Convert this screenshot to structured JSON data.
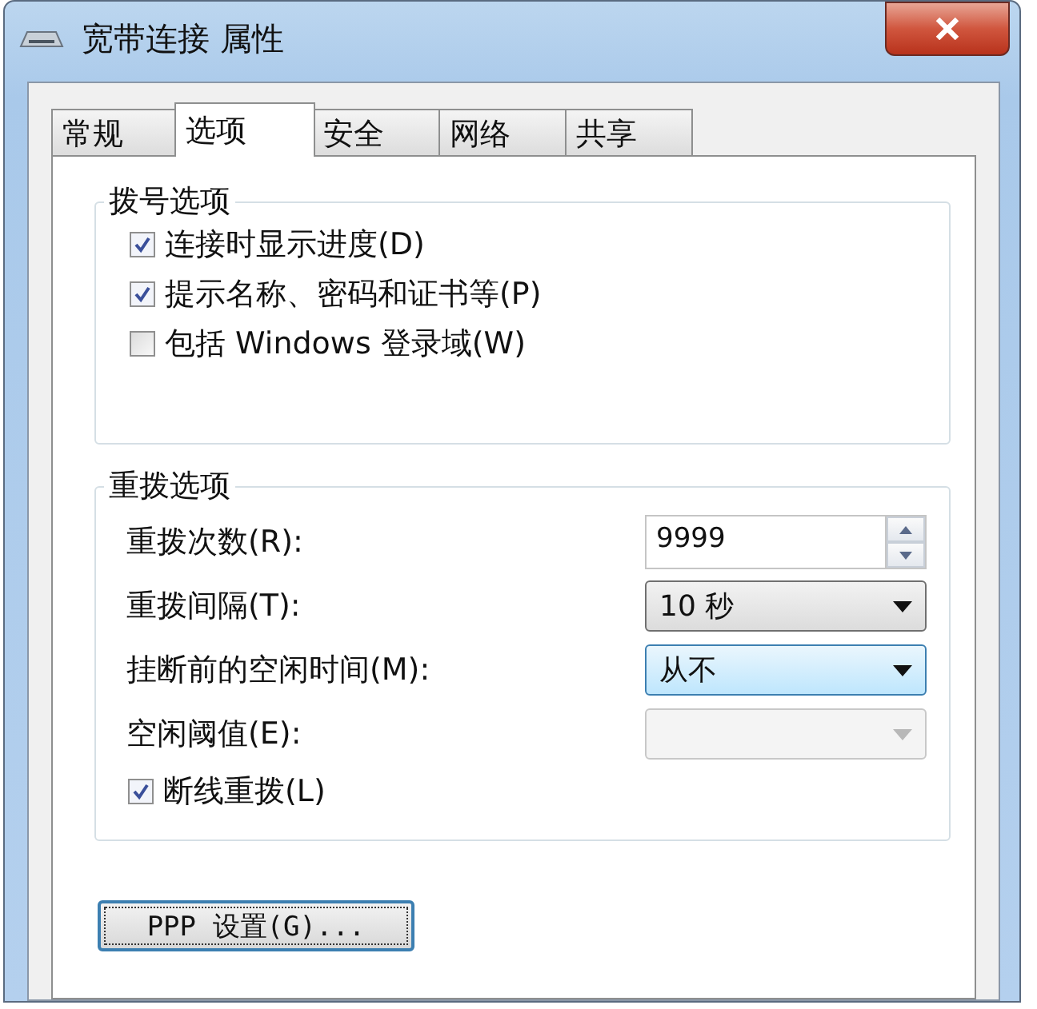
{
  "window": {
    "title": "宽带连接 属性"
  },
  "tabs": [
    {
      "label": "常规",
      "selected": false
    },
    {
      "label": "选项",
      "selected": true
    },
    {
      "label": "安全",
      "selected": false
    },
    {
      "label": "网络",
      "selected": false
    },
    {
      "label": "共享",
      "selected": false
    }
  ],
  "dial_options": {
    "legend": "拨号选项",
    "items": [
      {
        "label": "连接时显示进度(D)",
        "checked": true
      },
      {
        "label": "提示名称、密码和证书等(P)",
        "checked": true
      },
      {
        "label": "包括 Windows 登录域(W)",
        "checked": false
      }
    ]
  },
  "redial_options": {
    "legend": "重拨选项",
    "fields": [
      {
        "kind": "spinner",
        "label": "重拨次数(R):",
        "value": "9999",
        "focused": false,
        "disabled": false
      },
      {
        "kind": "dropdown",
        "label": "重拨间隔(T):",
        "value": "10 秒",
        "focused": false,
        "disabled": false
      },
      {
        "kind": "dropdown",
        "label": "挂断前的空闲时间(M):",
        "value": "从不",
        "focused": true,
        "disabled": false
      },
      {
        "kind": "dropdown",
        "label": "空闲阈值(E):",
        "focused": false,
        "disabled": true
      }
    ],
    "checkbox": {
      "label": "断线重拨(L)",
      "checked": true
    }
  },
  "button": "PPP 设置(G)..."
}
